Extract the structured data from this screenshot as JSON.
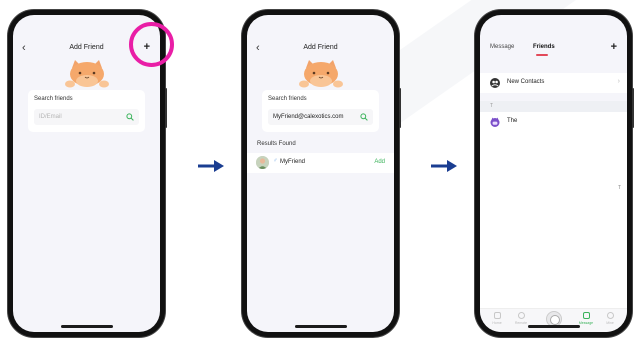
{
  "screen1": {
    "nav": {
      "back": "‹",
      "title": "Add Friend",
      "plus": "+"
    },
    "search": {
      "label": "Search friends",
      "placeholder": "ID/Email"
    }
  },
  "screen2": {
    "nav": {
      "back": "‹",
      "title": "Add Friend"
    },
    "search": {
      "label": "Search friends",
      "value": "MyFriend@calexotics.com"
    },
    "results": {
      "label": "Results Found",
      "items": [
        {
          "gender": "♂",
          "name": "MyFriend",
          "action": "Add"
        }
      ]
    }
  },
  "screen3": {
    "tabs": [
      {
        "label": "Message"
      },
      {
        "label": "Friends"
      }
    ],
    "plus": "+",
    "new_contacts": {
      "label": "New Contacts",
      "chevron": "›"
    },
    "section": "T",
    "friends": [
      {
        "name": "The"
      }
    ],
    "index_mark": "T",
    "bottom_nav": [
      {
        "label": "Home"
      },
      {
        "label": "Remote"
      },
      {
        "label": "Message"
      },
      {
        "label": "Mine"
      }
    ]
  },
  "colors": {
    "highlight": "#e91ea6",
    "arrow": "#1a3d91",
    "accent_green": "#3bb35b",
    "tab_underline": "#e24a5a"
  }
}
